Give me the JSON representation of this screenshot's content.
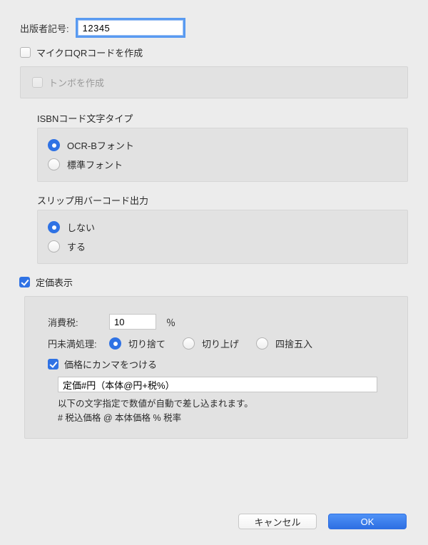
{
  "publisher": {
    "label": "出版者記号:",
    "value": "12345"
  },
  "micro_qr": {
    "label": "マイクロQRコードを作成",
    "checked": false
  },
  "trim": {
    "label": "トンボを作成",
    "checked": false,
    "disabled": true
  },
  "isbn_font": {
    "title": "ISBNコード文字タイプ",
    "options": [
      {
        "label": "OCR-Bフォント",
        "selected": true
      },
      {
        "label": "標準フォント",
        "selected": false
      }
    ]
  },
  "slip_barcode": {
    "title": "スリップ用バーコード出力",
    "options": [
      {
        "label": "しない",
        "selected": true
      },
      {
        "label": "する",
        "selected": false
      }
    ]
  },
  "show_price": {
    "label": "定価表示",
    "checked": true
  },
  "tax": {
    "label": "消費税:",
    "value": "10",
    "unit": "％"
  },
  "rounding": {
    "label": "円未満処理:",
    "options": [
      {
        "label": "切り捨て",
        "selected": true
      },
      {
        "label": "切り上げ",
        "selected": false
      },
      {
        "label": "四捨五入",
        "selected": false
      }
    ]
  },
  "comma": {
    "label": "価格にカンマをつける",
    "checked": true
  },
  "template": {
    "value": "定価#円（本体@円+税%）"
  },
  "help": {
    "line1": "以下の文字指定で数値が自動で差し込まれます。",
    "line2": "# 税込価格  @ 本体価格  % 税率"
  },
  "buttons": {
    "cancel": "キャンセル",
    "ok": "OK"
  }
}
